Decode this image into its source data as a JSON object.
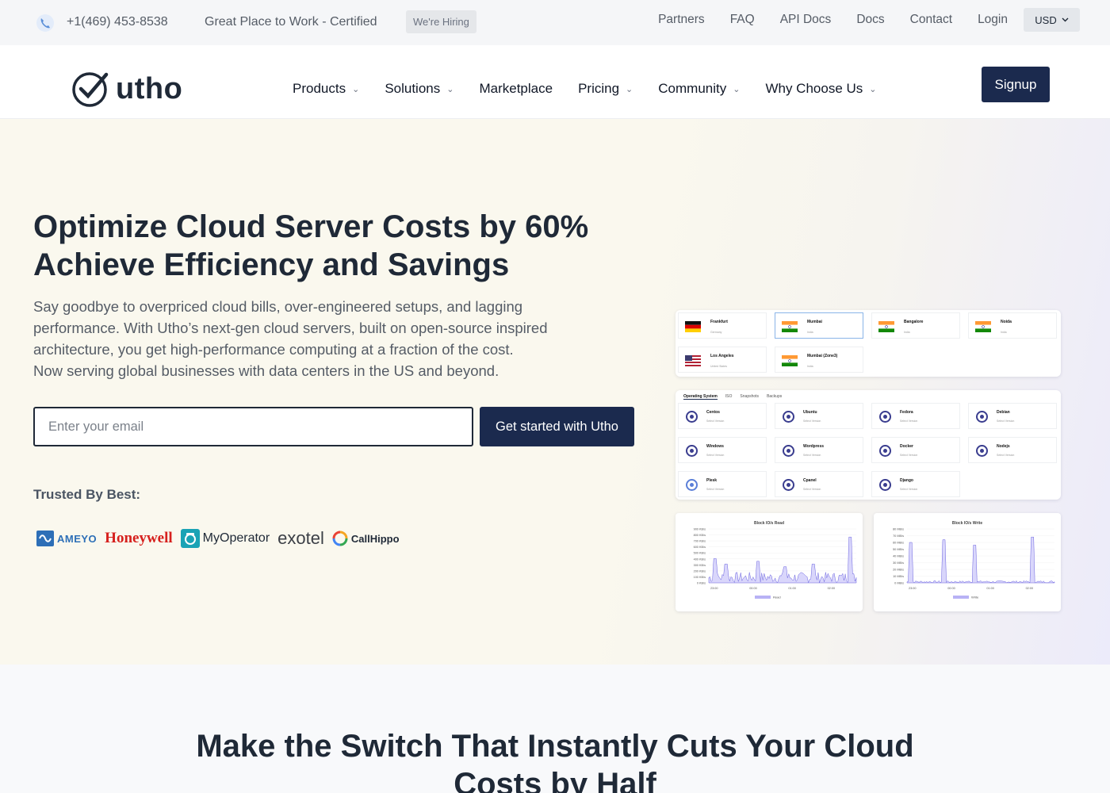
{
  "topbar": {
    "phone": "+1(469) 453-8538",
    "gptw": "Great Place to Work - Certified",
    "hiring": "We're Hiring",
    "links": [
      "Partners",
      "FAQ",
      "API Docs",
      "Docs",
      "Contact",
      "Login"
    ],
    "currency": "USD"
  },
  "header": {
    "logo_text": "utho",
    "nav": [
      "Products",
      "Solutions",
      "Marketplace",
      "Pricing",
      "Community",
      "Why Choose Us"
    ],
    "signup": "Signup"
  },
  "hero": {
    "title_line1": "Optimize Cloud Server Costs by 60%",
    "title_line2": "Achieve Efficiency and Savings",
    "desc_line1": "Say goodbye to overpriced cloud bills, over-engineered setups, and lagging",
    "desc_line2": "performance. With Utho’s next-gen cloud servers, built on open-source inspired",
    "desc_line3": "architecture, you get high-performance computing at a fraction of the cost.",
    "desc_line4": "Now serving global businesses with data centers in the US and beyond.",
    "email_placeholder": "Enter your email",
    "cta": "Get started with Utho",
    "trusted": "Trusted By Best:",
    "brands": {
      "ameyo": "AMEYO",
      "honeywell": "Honeywell",
      "myoperator": "MyOperator",
      "exotel": "exotel",
      "callhippo": "CallHippo"
    }
  },
  "dashboard": {
    "locations": [
      {
        "name": "Frankfurt",
        "sub": "Germany",
        "flag": "de"
      },
      {
        "name": "Mumbai",
        "sub": "India",
        "flag": "in"
      },
      {
        "name": "Bangalore",
        "sub": "India",
        "flag": "in"
      },
      {
        "name": "Noida",
        "sub": "India",
        "flag": "in"
      },
      {
        "name": "Los Angeles",
        "sub": "United States",
        "flag": "us"
      },
      {
        "name": "Mumbai (Zone3)",
        "sub": "India",
        "flag": "in"
      }
    ],
    "os_tabs": [
      "Operating System",
      "ISO",
      "Snapshots",
      "Backups"
    ],
    "os_items": [
      {
        "name": "Centos",
        "sub": "Select Version",
        "icon": "centos-icon"
      },
      {
        "name": "Ubuntu",
        "sub": "Select Version",
        "icon": "ubuntu-icon"
      },
      {
        "name": "Fedora",
        "sub": "Select Version",
        "icon": "fedora-icon"
      },
      {
        "name": "Debian",
        "sub": "Select Version",
        "icon": "debian-icon"
      },
      {
        "name": "Windows",
        "sub": "Select Version",
        "icon": "windows-icon"
      },
      {
        "name": "Wordpress",
        "sub": "Select Version",
        "icon": "wordpress-icon"
      },
      {
        "name": "Docker",
        "sub": "Select Version",
        "icon": "docker-icon"
      },
      {
        "name": "Nodejs",
        "sub": "Select Version",
        "icon": "nodejs-icon"
      },
      {
        "name": "Plesk",
        "sub": "Select Version",
        "icon": "plesk-icon"
      },
      {
        "name": "Cpanel",
        "sub": "Select Version",
        "icon": "cpanel-icon"
      },
      {
        "name": "Django",
        "sub": "Select Version",
        "icon": "django-icon"
      }
    ],
    "read_chart": {
      "title": "Block IO/s Read",
      "yticks": [
        "900 KB/s",
        "800 KB/s",
        "700 KB/s",
        "600 KB/s",
        "500 KB/s",
        "400 KB/s",
        "300 KB/s",
        "200 KB/s",
        "100 KB/s",
        "0 KB/s"
      ],
      "xticks": [
        "23:00",
        "00:00",
        "01:00",
        "02:00"
      ],
      "legend": "Read"
    },
    "write_chart": {
      "title": "Block IO/s Write",
      "yticks": [
        "80 MB/s",
        "70 MB/s",
        "60 MB/s",
        "50 MB/s",
        "40 MB/s",
        "30 MB/s",
        "20 MB/s",
        "10 MB/s",
        "0 MB/s"
      ],
      "xticks": [
        "23:00",
        "00:00",
        "01:00",
        "02:00"
      ],
      "legend": "Write"
    }
  },
  "section2": {
    "title_line1": "Make the Switch That Instantly Cuts Your Cloud",
    "title_line2": "Costs by Half"
  },
  "colors": {
    "primary": "#1b2a4e",
    "hero_bg": "#faf8ee",
    "accent_red": "#d6201d"
  }
}
